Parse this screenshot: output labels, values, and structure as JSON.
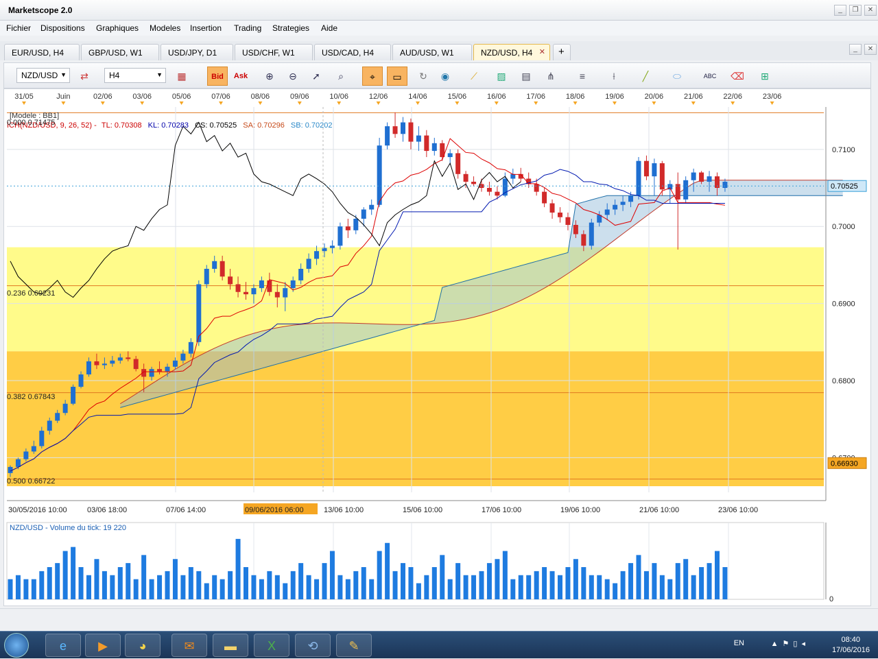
{
  "window": {
    "title": "Marketscope 2.0"
  },
  "menu": [
    "Fichier",
    "Dispositions",
    "Graphiques",
    "Modeles",
    "Insertion",
    "Trading",
    "Strategies",
    "Aide"
  ],
  "tabs": [
    "EUR/USD, H4",
    "GBP/USD, W1",
    "USD/JPY, D1",
    "USD/CHF, W1",
    "USD/CAD, H4",
    "AUD/USD, W1",
    "NZD/USD, H4"
  ],
  "active_tab_index": 6,
  "toolbar": {
    "symbol": "NZD/USD",
    "timeframe": "H4",
    "bid_label": "Bid",
    "ask_label": "Ask"
  },
  "chart": {
    "top_dates": [
      "31/05",
      "Juin",
      "02/06",
      "03/06",
      "05/06",
      "07/06",
      "08/06",
      "09/06",
      "10/06",
      "12/06",
      "14/06",
      "15/06",
      "16/06",
      "17/06",
      "18/06",
      "19/06",
      "20/06",
      "21/06",
      "22/06",
      "23/06"
    ],
    "bottom_dates": [
      "30/05/2016 10:00",
      "03/06 18:00",
      "07/06 14:00",
      "09/06/2016 06:00",
      "13/06 10:00",
      "15/06 10:00",
      "17/06 10:00",
      "19/06 10:00",
      "21/06 10:00",
      "23/06 10:00"
    ],
    "price_ticks": [
      "0.7100",
      "0.7000",
      "0.6900",
      "0.6800",
      "0.6700"
    ],
    "current_price": "0.70525",
    "marker_price": "0.66930",
    "model_label": "[Modele : BB1]",
    "ichimoku": {
      "name": "ICH(NZD/USD, 9, 26, 52) -",
      "tl": "TL: 0.70308",
      "kl": "KL: 0.70283",
      "cs": "CS: 0.70525",
      "sa": "SA: 0.70296",
      "sb": "SB: 0.70202"
    },
    "fib_labels": [
      "0.000 0.71475",
      "0.236 0.69231",
      "0.382 0.67843",
      "0.500 0.66722"
    ],
    "volume_label": "NZD/USD - Volume du tick: 19 220",
    "volume_zero": "0"
  },
  "chart_data": {
    "type": "candlestick",
    "symbol": "NZD/USD",
    "timeframe": "H4",
    "ylim": [
      0.6655,
      0.7155
    ],
    "candles": [
      [
        0.668,
        0.669,
        0.6675,
        0.6688
      ],
      [
        0.6688,
        0.67,
        0.6685,
        0.6698
      ],
      [
        0.6698,
        0.6712,
        0.6695,
        0.6708
      ],
      [
        0.6708,
        0.6722,
        0.6705,
        0.6715
      ],
      [
        0.6715,
        0.674,
        0.6712,
        0.6735
      ],
      [
        0.6735,
        0.6752,
        0.673,
        0.6748
      ],
      [
        0.6748,
        0.6762,
        0.6745,
        0.6758
      ],
      [
        0.6758,
        0.6775,
        0.6755,
        0.677
      ],
      [
        0.677,
        0.6795,
        0.6768,
        0.6792
      ],
      [
        0.6792,
        0.6812,
        0.679,
        0.6808
      ],
      [
        0.6808,
        0.683,
        0.6805,
        0.6825
      ],
      [
        0.6825,
        0.6835,
        0.6815,
        0.682
      ],
      [
        0.682,
        0.683,
        0.6815,
        0.6822
      ],
      [
        0.6822,
        0.6832,
        0.6818,
        0.6826
      ],
      [
        0.6826,
        0.6835,
        0.6822,
        0.683
      ],
      [
        0.683,
        0.6838,
        0.6825,
        0.6828
      ],
      [
        0.6828,
        0.6832,
        0.6812,
        0.6815
      ],
      [
        0.6815,
        0.6822,
        0.6785,
        0.6805
      ],
      [
        0.6805,
        0.6818,
        0.68,
        0.6815
      ],
      [
        0.6815,
        0.6825,
        0.6808,
        0.6812
      ],
      [
        0.6812,
        0.6822,
        0.6805,
        0.6818
      ],
      [
        0.6818,
        0.683,
        0.6815,
        0.6826
      ],
      [
        0.6826,
        0.684,
        0.6822,
        0.6835
      ],
      [
        0.6835,
        0.6855,
        0.683,
        0.685
      ],
      [
        0.685,
        0.693,
        0.6845,
        0.6925
      ],
      [
        0.6925,
        0.695,
        0.692,
        0.6945
      ],
      [
        0.6945,
        0.6962,
        0.694,
        0.6955
      ],
      [
        0.6955,
        0.6962,
        0.693,
        0.6935
      ],
      [
        0.6935,
        0.6945,
        0.6918,
        0.6925
      ],
      [
        0.6925,
        0.6935,
        0.6908,
        0.6915
      ],
      [
        0.6915,
        0.6928,
        0.6905,
        0.6912
      ],
      [
        0.6912,
        0.6925,
        0.69,
        0.692
      ],
      [
        0.692,
        0.6935,
        0.6915,
        0.693
      ],
      [
        0.693,
        0.694,
        0.691,
        0.6915
      ],
      [
        0.6915,
        0.6925,
        0.6895,
        0.6908
      ],
      [
        0.6908,
        0.6928,
        0.689,
        0.692
      ],
      [
        0.692,
        0.6935,
        0.6915,
        0.693
      ],
      [
        0.693,
        0.6952,
        0.6925,
        0.6945
      ],
      [
        0.6945,
        0.6965,
        0.694,
        0.6958
      ],
      [
        0.6958,
        0.6975,
        0.695,
        0.6968
      ],
      [
        0.6968,
        0.6978,
        0.696,
        0.6972
      ],
      [
        0.6972,
        0.6982,
        0.6965,
        0.6975
      ],
      [
        0.6975,
        0.7005,
        0.697,
        0.7
      ],
      [
        0.7,
        0.701,
        0.6985,
        0.6995
      ],
      [
        0.6995,
        0.7015,
        0.699,
        0.701
      ],
      [
        0.701,
        0.7025,
        0.7,
        0.7022
      ],
      [
        0.7022,
        0.7035,
        0.7015,
        0.7028
      ],
      [
        0.7028,
        0.7115,
        0.7025,
        0.7105
      ],
      [
        0.7105,
        0.7135,
        0.71,
        0.713
      ],
      [
        0.713,
        0.7148,
        0.7115,
        0.712
      ],
      [
        0.712,
        0.7142,
        0.711,
        0.7135
      ],
      [
        0.7135,
        0.714,
        0.71,
        0.711
      ],
      [
        0.711,
        0.713,
        0.7098,
        0.7118
      ],
      [
        0.7118,
        0.7125,
        0.709,
        0.7098
      ],
      [
        0.7098,
        0.7115,
        0.7092,
        0.7108
      ],
      [
        0.7108,
        0.7112,
        0.7085,
        0.709
      ],
      [
        0.709,
        0.71,
        0.708,
        0.7095
      ],
      [
        0.7095,
        0.71,
        0.7062,
        0.7068
      ],
      [
        0.7068,
        0.7072,
        0.705,
        0.7058
      ],
      [
        0.7058,
        0.7065,
        0.7052,
        0.7055
      ],
      [
        0.7055,
        0.7062,
        0.7045,
        0.705
      ],
      [
        0.705,
        0.7058,
        0.704,
        0.7045
      ],
      [
        0.7045,
        0.7052,
        0.7035,
        0.704
      ],
      [
        0.704,
        0.707,
        0.7038,
        0.7062
      ],
      [
        0.7062,
        0.7075,
        0.7055,
        0.7068
      ],
      [
        0.7068,
        0.7076,
        0.7058,
        0.7062
      ],
      [
        0.7062,
        0.707,
        0.705,
        0.7055
      ],
      [
        0.7055,
        0.7062,
        0.704,
        0.7045
      ],
      [
        0.7045,
        0.705,
        0.7025,
        0.703
      ],
      [
        0.703,
        0.7035,
        0.701,
        0.7018
      ],
      [
        0.7018,
        0.7025,
        0.7005,
        0.7012
      ],
      [
        0.7012,
        0.7018,
        0.6995,
        0.7002
      ],
      [
        0.7002,
        0.7008,
        0.6985,
        0.699
      ],
      [
        0.699,
        0.6995,
        0.6968,
        0.6975
      ],
      [
        0.6975,
        0.701,
        0.697,
        0.7005
      ],
      [
        0.7005,
        0.702,
        0.7,
        0.7015
      ],
      [
        0.7015,
        0.703,
        0.7008,
        0.7022
      ],
      [
        0.7022,
        0.7035,
        0.7015,
        0.7028
      ],
      [
        0.7028,
        0.704,
        0.702,
        0.7032
      ],
      [
        0.7032,
        0.7045,
        0.7025,
        0.704
      ],
      [
        0.704,
        0.709,
        0.7035,
        0.7085
      ],
      [
        0.7085,
        0.7092,
        0.706,
        0.7065
      ],
      [
        0.7065,
        0.7088,
        0.704,
        0.7082
      ],
      [
        0.7082,
        0.7085,
        0.704,
        0.7048
      ],
      [
        0.7048,
        0.706,
        0.703,
        0.7055
      ],
      [
        0.7055,
        0.707,
        0.697,
        0.7035
      ],
      [
        0.7035,
        0.7065,
        0.703,
        0.706
      ],
      [
        0.706,
        0.7075,
        0.7045,
        0.707
      ],
      [
        0.707,
        0.7072,
        0.7055,
        0.7058
      ],
      [
        0.7058,
        0.7072,
        0.7045,
        0.7065
      ],
      [
        0.7065,
        0.707,
        0.704,
        0.705
      ],
      [
        0.705,
        0.7062,
        0.7045,
        0.7058
      ]
    ],
    "fib_levels": [
      {
        "ratio": 0.0,
        "price": 0.71475
      },
      {
        "ratio": 0.236,
        "price": 0.69231
      },
      {
        "ratio": 0.382,
        "price": 0.67843
      },
      {
        "ratio": 0.5,
        "price": 0.66722
      }
    ],
    "volume": {
      "name": "NZD/USD - Volume du tick",
      "last": 19220,
      "values": [
        5,
        6,
        5,
        5,
        7,
        8,
        9,
        12,
        13,
        8,
        6,
        10,
        7,
        6,
        8,
        9,
        5,
        11,
        5,
        6,
        7,
        10,
        6,
        8,
        7,
        4,
        6,
        5,
        7,
        15,
        8,
        6,
        5,
        7,
        6,
        4,
        7,
        9,
        6,
        5,
        9,
        12,
        6,
        5,
        7,
        8,
        5,
        12,
        14,
        7,
        9,
        8,
        4,
        6,
        8,
        11,
        5,
        9,
        6,
        6,
        7,
        9,
        10,
        12,
        5,
        6,
        6,
        7,
        8,
        7,
        6,
        8,
        10,
        8,
        6,
        6,
        5,
        4,
        7,
        9,
        11,
        7,
        9,
        6,
        5,
        9,
        10,
        6,
        8,
        9,
        12,
        8
      ]
    }
  }
}
